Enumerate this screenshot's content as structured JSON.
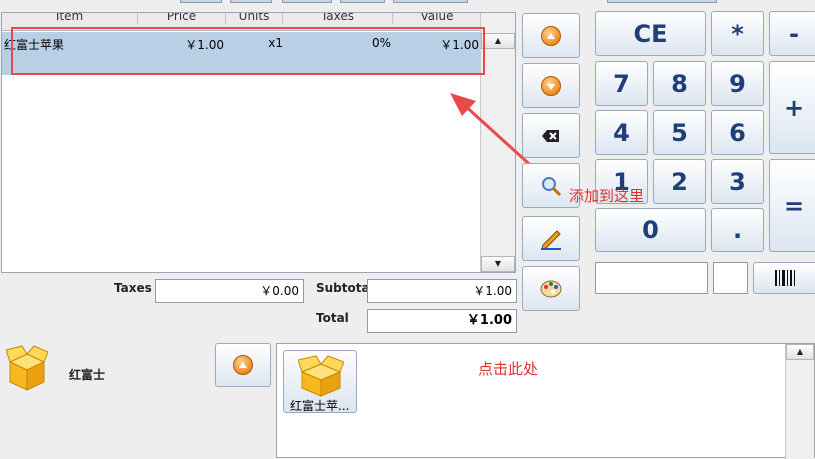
{
  "ticket": {
    "columns": [
      "Item",
      "Price",
      "Units",
      "Taxes",
      "Value"
    ],
    "rows": [
      {
        "item": "红富士苹果",
        "price": "￥1.00",
        "units": "x1",
        "taxes": "0%",
        "value": "￥1.00"
      }
    ]
  },
  "totals": {
    "taxes_label": "Taxes",
    "taxes_value": "￥0.00",
    "subtotal_label": "Subtotal",
    "subtotal_value": "￥1.00",
    "total_label": "Total",
    "total_value": "￥1.00"
  },
  "keypad": {
    "ce": "CE",
    "multiply": "*",
    "minus": "-",
    "plus": "+",
    "equals": "=",
    "k7": "7",
    "k8": "8",
    "k9": "9",
    "k4": "4",
    "k5": "5",
    "k6": "6",
    "k1": "1",
    "k2": "2",
    "k3": "3",
    "k0": "0",
    "dot": "."
  },
  "category": {
    "name": "红富士",
    "product_label": "红富士苹..."
  },
  "annotations": {
    "add_here": "添加到这里",
    "click_here": "点击此处"
  },
  "colors": {
    "annotation": "#e03030",
    "selected_row": "#b8cfe5",
    "key_text": "#1f3f7a"
  }
}
